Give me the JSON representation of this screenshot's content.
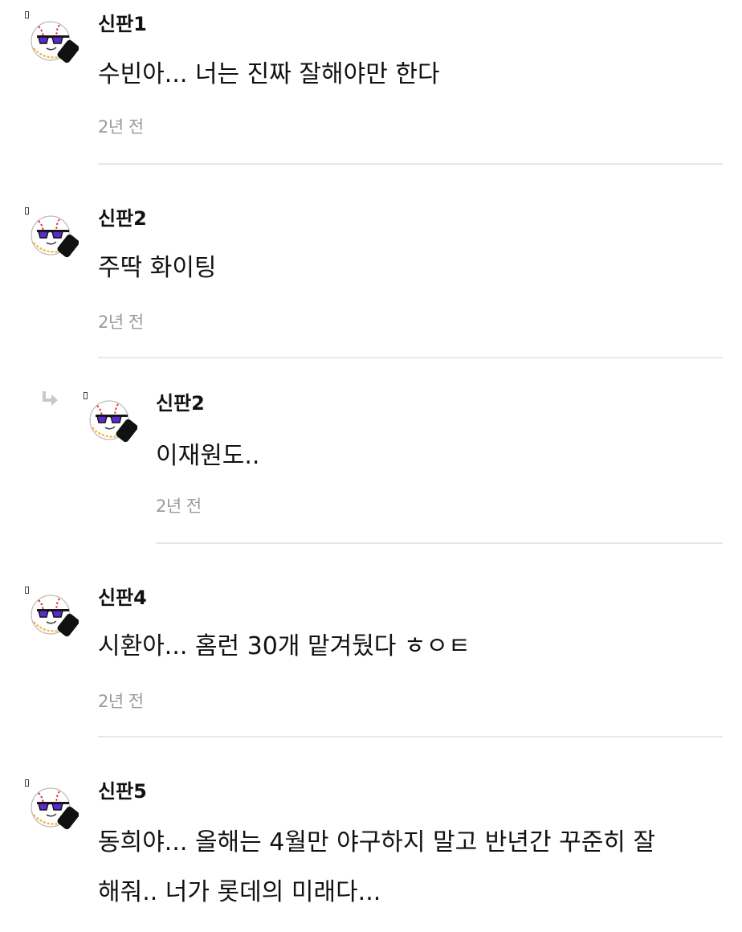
{
  "comments": [
    {
      "username": "신판1",
      "lines": [
        "수빈아... 너는 진짜 잘해야만 한다"
      ],
      "time": "2년 전",
      "is_reply": false
    },
    {
      "username": "신판2",
      "lines": [
        "주딱 화이팅"
      ],
      "time": "2년 전",
      "is_reply": false
    },
    {
      "username": "신판2",
      "lines": [
        "이재원도.."
      ],
      "time": "2년 전",
      "is_reply": true
    },
    {
      "username": "신판4",
      "lines": [
        "시환아... 홈런 30개 맡겨뒀다 ㅎㅇㅌ"
      ],
      "time": "2년 전",
      "is_reply": false
    },
    {
      "username": "신판5",
      "lines": [
        "동희야... 올해는 4월만 야구하지 말고 반년간 꾸준히 잘",
        "해줘.. 너가 롯데의 미래다..."
      ],
      "time": "",
      "is_reply": false
    }
  ],
  "icons": {
    "avatar": "baseball-sunglasses-avatar",
    "rank": "rank-marker-icon",
    "reply": "reply-arrow-icon"
  },
  "colors": {
    "text": "#111111",
    "timestamp": "#9a9a9a",
    "divider": "#e8e8e8",
    "reply_arrow": "#c8c8c8"
  }
}
